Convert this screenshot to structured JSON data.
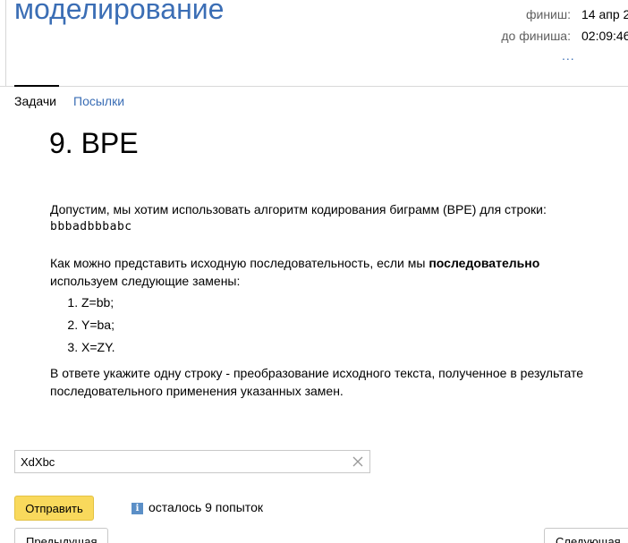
{
  "header": {
    "contest_title": "моделирование",
    "timer": {
      "finish_label": "финиш:",
      "finish_value": "14 апр 2",
      "remaining_label": "до финиша:",
      "remaining_value": "02:09:46",
      "more_label": "..."
    }
  },
  "tabs": [
    {
      "label": "Задачи",
      "active": true
    },
    {
      "label": "Посылки",
      "active": false
    }
  ],
  "problem": {
    "title": "9. BPE",
    "intro": "Допустим, мы хотим использовать алгоритм кодирования биграмм (BPE) для строки:",
    "input_string": "bbbadbbbabc",
    "question_before_bold": "Как можно представить исходную последовательность, если мы ",
    "question_bold": "последовательно",
    "question_after_bold": " используем следующие замены:",
    "rules": [
      "Z=bb;",
      "Y=ba;",
      "X=ZY."
    ],
    "instruction": "В ответе укажите одну строку - преобразование исходного текста, полученное в результате последовательного применения указанных замен."
  },
  "answer": {
    "value": "XdXbc"
  },
  "actions": {
    "submit_label": "Отправить",
    "attempts_text": "осталось 9 попыток",
    "info_icon_glyph": "i",
    "prev_label": "Предыдущая",
    "next_label": "Следующая"
  },
  "colors": {
    "link": "#3b6eb5",
    "submit_bg": "#f9d95c",
    "info_icon": "#5b8fc7"
  }
}
